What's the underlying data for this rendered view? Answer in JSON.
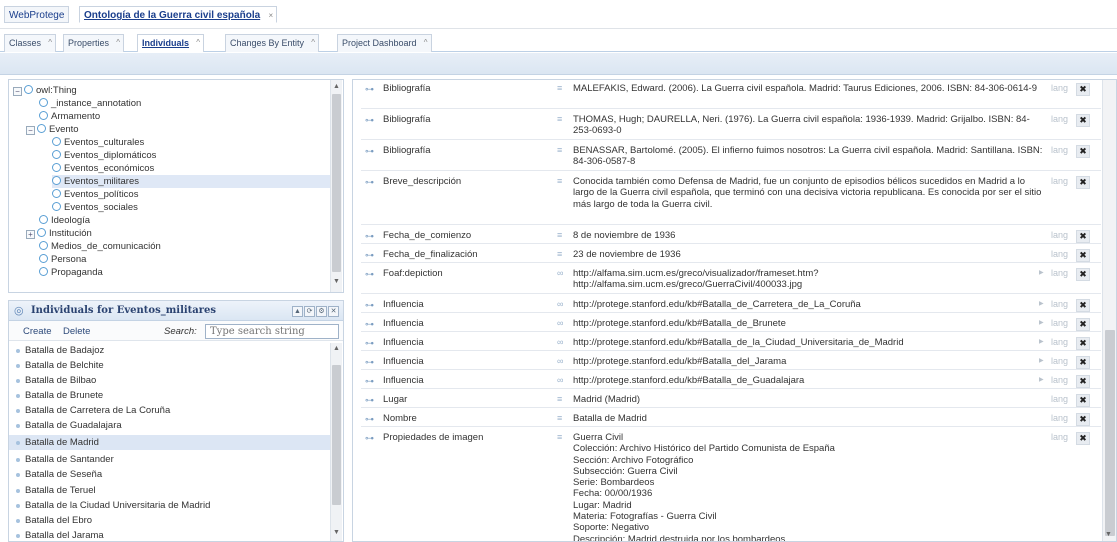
{
  "top_tabs": {
    "webprotege": "WebProtege",
    "project": "Ontología de la Guerra civil española",
    "close": "×"
  },
  "view_tabs": [
    {
      "label": "Classes"
    },
    {
      "label": "Properties"
    },
    {
      "label": "Individuals"
    },
    {
      "label": "Changes By Entity"
    },
    {
      "label": "Project Dashboard"
    }
  ],
  "tab_close": "^",
  "class_tree": [
    {
      "label": "owl:Thing",
      "toggle": "−"
    },
    {
      "label": "_instance_annotation"
    },
    {
      "label": "Armamento"
    },
    {
      "label": "Evento",
      "toggle": "−"
    },
    {
      "label": "Eventos_culturales"
    },
    {
      "label": "Eventos_diplomáticos"
    },
    {
      "label": "Eventos_económicos"
    },
    {
      "label": "Eventos_militares"
    },
    {
      "label": "Eventos_políticos"
    },
    {
      "label": "Eventos_sociales"
    },
    {
      "label": "Ideología"
    },
    {
      "label": "Institución",
      "toggle": "+"
    },
    {
      "label": "Medios_de_comunicación"
    },
    {
      "label": "Persona"
    },
    {
      "label": "Propaganda"
    }
  ],
  "individuals_panel": {
    "title": "Individuals for Eventos_militares",
    "create": "Create",
    "delete": "Delete",
    "search_label": "Search:",
    "search_placeholder": "Type search string",
    "items": [
      "Batalla de Badajoz",
      "Batalla de Belchite",
      "Batalla de Bilbao",
      "Batalla de Brunete",
      "Batalla de Carretera de La Coruña",
      "Batalla de Guadalajara",
      "Batalla de Madrid",
      "Batalla de Santander",
      "Batalla de Seseña",
      "Batalla de Teruel",
      "Batalla de la Ciudad Universitaria de Madrid",
      "Batalla del Ebro",
      "Batalla del Jarama"
    ],
    "selected": "Batalla de Madrid"
  },
  "properties": [
    {
      "name": "Bibliografía",
      "value": "MALEFAKIS, Edward. (2006). La Guerra civil española. Madrid: Taurus Ediciones, 2006. ISBN: 84-306-0614-9",
      "type": "text"
    },
    {
      "name": "Bibliografía",
      "value": "THOMAS, Hugh; DAURELLA, Neri. (1976). La Guerra civil española: 1936-1939. Madrid: Grijalbo.  ISBN: 84-253-0693-0",
      "type": "text"
    },
    {
      "name": "Bibliografía",
      "value": "BENASSAR, Bartolomé. (2005). El infierno fuimos nosotros: La Guerra civil española. Madrid: Santillana. ISBN: 84-306-0587-8",
      "type": "text"
    },
    {
      "name": "Breve_descripción",
      "value": "Conocida también como Defensa de Madrid, fue un conjunto de episodios bélicos sucedidos en Madrid a lo largo de la Guerra civil española, que terminó con una decisiva victoria republicana. Es conocida por ser el sitio más largo de toda la Guerra civil.",
      "type": "text"
    },
    {
      "name": "Fecha_de_comienzo",
      "value": "8 de noviembre de 1936",
      "type": "text"
    },
    {
      "name": "Fecha_de_finalización",
      "value": "23 de noviembre de 1936",
      "type": "text"
    },
    {
      "name": "Foaf:depiction",
      "value": "http://alfama.sim.ucm.es/greco/visualizador/frameset.htm?\nhttp://alfama.sim.ucm.es/greco/GuerraCivil/400033.jpg",
      "type": "link"
    },
    {
      "name": "Influencia",
      "value": "http://protege.stanford.edu/kb#Batalla_de_Carretera_de_La_Coruña",
      "type": "link"
    },
    {
      "name": "Influencia",
      "value": "http://protege.stanford.edu/kb#Batalla_de_Brunete",
      "type": "link"
    },
    {
      "name": "Influencia",
      "value": "http://protege.stanford.edu/kb#Batalla_de_la_Ciudad_Universitaria_de_Madrid",
      "type": "link"
    },
    {
      "name": "Influencia",
      "value": "http://protege.stanford.edu/kb#Batalla_del_Jarama",
      "type": "link"
    },
    {
      "name": "Influencia",
      "value": "http://protege.stanford.edu/kb#Batalla_de_Guadalajara",
      "type": "link"
    },
    {
      "name": "Lugar",
      "value": "Madrid (Madrid)",
      "type": "text"
    },
    {
      "name": "Nombre",
      "value": "Batalla de Madrid",
      "type": "text"
    },
    {
      "name": "Propiedades de imagen",
      "value": "Guerra Civil\nColección: Archivo Histórico del Partido Comunista de España\nSección: Archivo Fotográfico\nSubsección: Guerra Civil\nSerie: Bombardeos\nFecha: 00/00/1936\nLugar: Madrid\nMateria: Fotografías - Guerra Civil\nSoporte: Negativo\nDescripción: Madrid destruida por los bombardeos.",
      "type": "text"
    }
  ],
  "lang_label": "lang",
  "delete_glyph": "✖"
}
